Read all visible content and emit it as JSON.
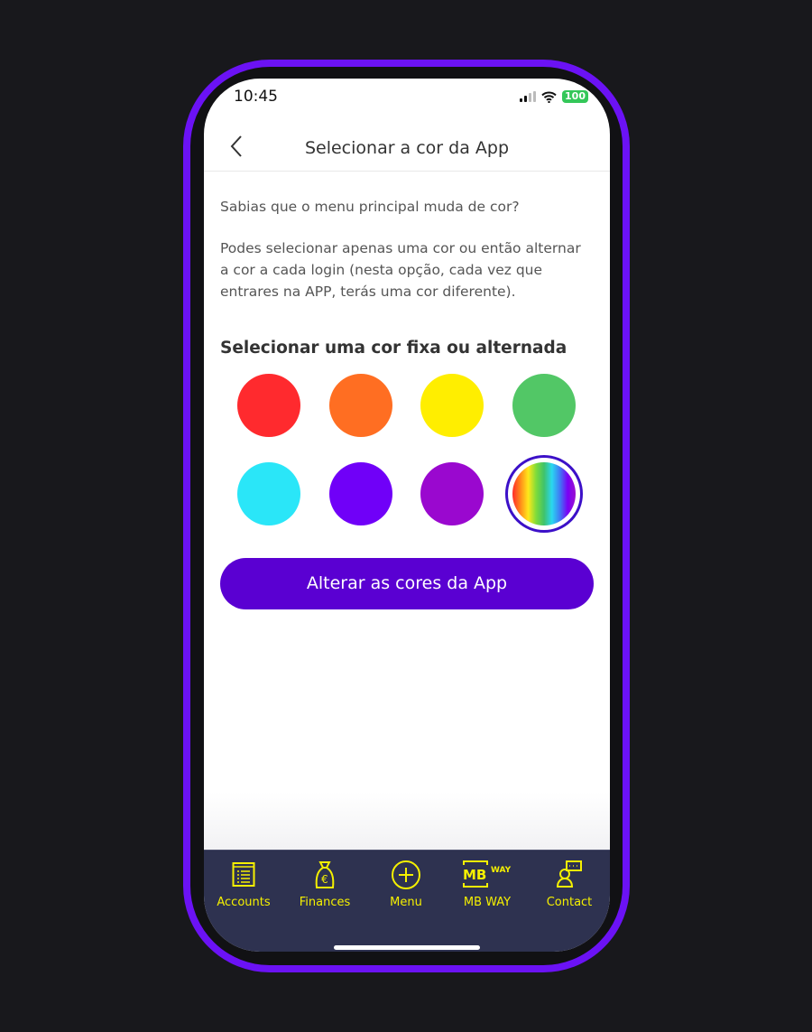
{
  "status": {
    "time": "10:45",
    "battery": "100"
  },
  "header": {
    "title": "Selecionar a cor da App"
  },
  "content": {
    "intro": "Sabias que o menu principal muda de cor?",
    "description": "Podes selecionar apenas uma cor ou então alternar a cor a cada login (nesta opção, cada vez que entrares na APP, terás uma cor diferente).",
    "section_title": "Selecionar uma cor fixa ou alternada"
  },
  "colors": [
    {
      "name": "red",
      "hex": "#ff2a2e"
    },
    {
      "name": "orange",
      "hex": "#ff6e22"
    },
    {
      "name": "yellow",
      "hex": "#ffee00"
    },
    {
      "name": "green",
      "hex": "#52c766"
    },
    {
      "name": "cyan",
      "hex": "#2ae6f8"
    },
    {
      "name": "violet",
      "hex": "#7000f8"
    },
    {
      "name": "purple",
      "hex": "#9a08cf"
    },
    {
      "name": "rainbow",
      "hex": "rainbow",
      "selected": true
    }
  ],
  "button": {
    "label": "Alterar as cores da App"
  },
  "nav": {
    "items": [
      {
        "label": "Accounts",
        "icon": "list-icon"
      },
      {
        "label": "Finances",
        "icon": "money-bag-icon"
      },
      {
        "label": "Menu",
        "icon": "plus-circle-icon"
      },
      {
        "label": "MB WAY",
        "icon": "mbway-icon",
        "logo_text": "MB WAY"
      },
      {
        "label": "Contact",
        "icon": "contact-icon"
      }
    ]
  },
  "accent": "#5a00d2",
  "nav_color": "#2e3250",
  "nav_icon_color": "#f5f000"
}
